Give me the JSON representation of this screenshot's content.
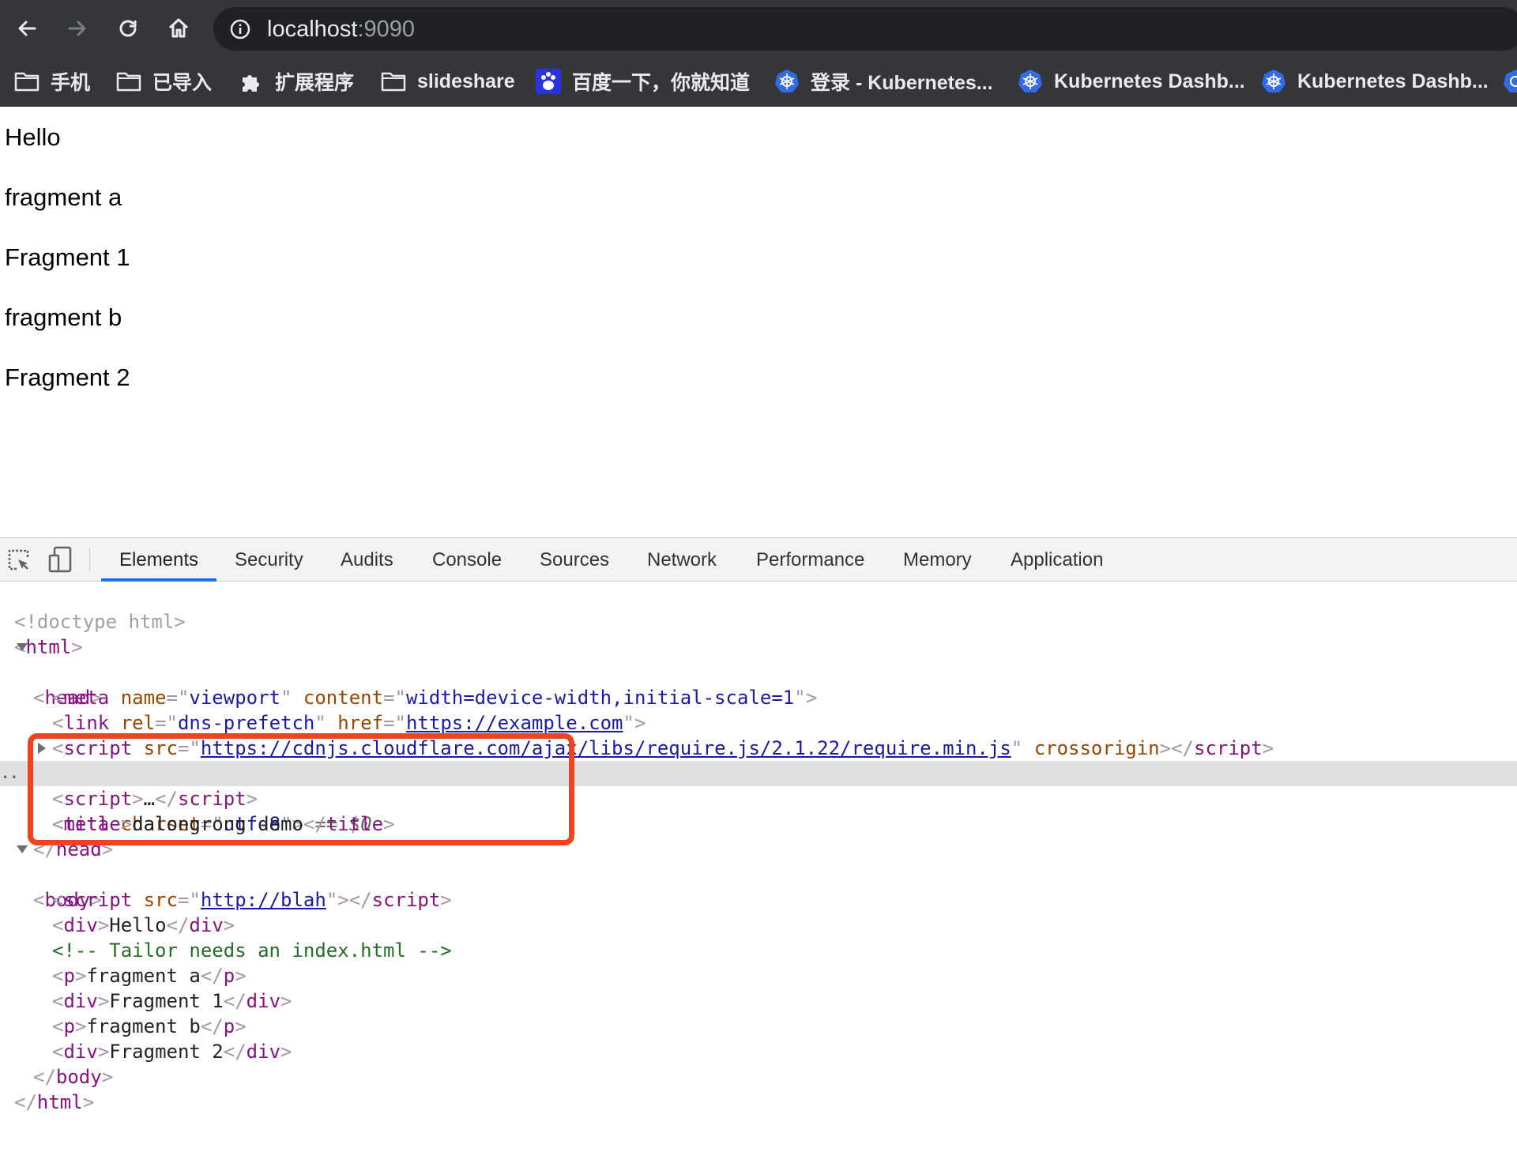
{
  "browser": {
    "url_host": "localhost",
    "url_port": ":9090",
    "bookmarks": [
      {
        "icon": "folder-icon",
        "label": "手机"
      },
      {
        "icon": "folder-icon",
        "label": "已导入"
      },
      {
        "icon": "puzzle-icon",
        "label": "扩展程序"
      },
      {
        "icon": "folder-icon",
        "label": "slideshare"
      },
      {
        "icon": "baidu-icon",
        "label": "百度一下，你就知道"
      },
      {
        "icon": "kubernetes-icon",
        "label": "登录 - Kubernetes..."
      },
      {
        "icon": "kubernetes-icon",
        "label": "Kubernetes Dashb..."
      },
      {
        "icon": "kubernetes-icon",
        "label": "Kubernetes Dashb..."
      }
    ]
  },
  "page": {
    "lines": [
      "Hello",
      "fragment a",
      "Fragment 1",
      "fragment b",
      "Fragment 2"
    ]
  },
  "devtools": {
    "tabs": [
      "Elements",
      "Security",
      "Audits",
      "Console",
      "Sources",
      "Network",
      "Performance",
      "Memory",
      "Application"
    ],
    "active_tab": "Elements",
    "dom": {
      "doctype": "<!doctype html>",
      "html_open": "html",
      "head_open": "head",
      "meta_viewport": {
        "tag": "meta",
        "attr1": "name",
        "val1": "viewport",
        "attr2": "content",
        "val2": "width=device-width,initial-scale=1"
      },
      "link_prefetch": {
        "tag": "link",
        "attr1": "rel",
        "val1": "dns-prefetch",
        "attr2": "href",
        "val2": "https://example.com"
      },
      "script_require": {
        "tag": "script",
        "attr1": "src",
        "val1": "https://cdnjs.cloudflare.com/ajax/libs/require.js/2.1.22/require.min.js",
        "attr2": "crossorigin"
      },
      "script_collapsed": {
        "tag": "script",
        "ellipsis": "…"
      },
      "meta_charset": {
        "tag": "meta",
        "attr": "charset",
        "val": "utf-8",
        "selected_marker": "== $0"
      },
      "title": {
        "tag": "title",
        "text": "dalongrong demo"
      },
      "head_close": "head",
      "body_open": "body",
      "script_blah": {
        "tag": "script",
        "attr": "src",
        "val": "http://blah"
      },
      "div_hello": {
        "tag": "div",
        "text": "Hello"
      },
      "comment": "<!-- Tailor needs an index.html -->",
      "p_a": {
        "tag": "p",
        "text": "fragment a"
      },
      "div_1": {
        "tag": "div",
        "text": "Fragment 1"
      },
      "p_b": {
        "tag": "p",
        "text": "fragment b"
      },
      "div_2": {
        "tag": "div",
        "text": "Fragment 2"
      },
      "body_close": "body",
      "html_close": "html"
    },
    "gutter_ellipsis": "..",
    "highlight_color": "#f2431f"
  }
}
